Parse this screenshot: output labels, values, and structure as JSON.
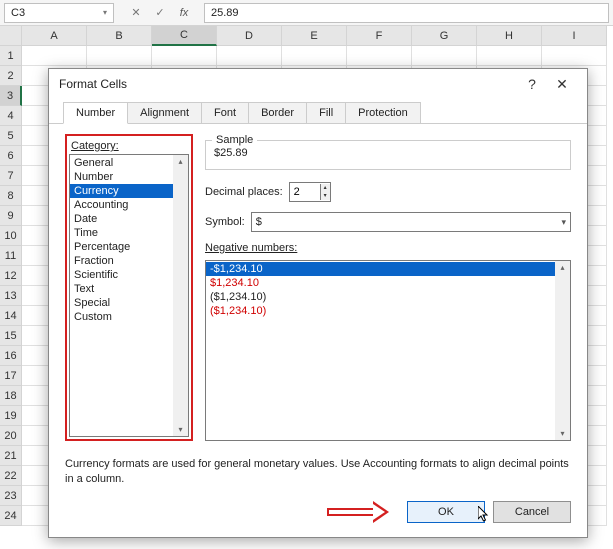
{
  "namebox": {
    "value": "C3",
    "dropdown_glyph": "▾"
  },
  "fx": {
    "cancel": "✕",
    "confirm": "✓",
    "fx_label": "fx"
  },
  "formula_bar": {
    "value": "25.89"
  },
  "columns": [
    "A",
    "B",
    "C",
    "D",
    "E",
    "F",
    "G",
    "H",
    "I"
  ],
  "selected_col_index": 2,
  "selected_row": 3,
  "row_count": 24,
  "dialog": {
    "title": "Format Cells",
    "help": "?",
    "close": "✕",
    "tabs": [
      "Number",
      "Alignment",
      "Font",
      "Border",
      "Fill",
      "Protection"
    ],
    "active_tab": 0,
    "category_label": "Category:",
    "categories": [
      "General",
      "Number",
      "Currency",
      "Accounting",
      "Date",
      "Time",
      "Percentage",
      "Fraction",
      "Scientific",
      "Text",
      "Special",
      "Custom"
    ],
    "selected_category_index": 2,
    "sample_label": "Sample",
    "sample_value": "$25.89",
    "decimal_label": "Decimal places:",
    "decimal_value": "2",
    "symbol_label": "Symbol:",
    "symbol_value": "$",
    "symbol_dd": "▾",
    "neg_label": "Negative numbers:",
    "neg_options": [
      {
        "text": "-$1,234.10",
        "red": false,
        "sel": true
      },
      {
        "text": "$1,234.10",
        "red": true,
        "sel": false
      },
      {
        "text": "($1,234.10)",
        "red": false,
        "sel": false
      },
      {
        "text": "($1,234.10)",
        "red": true,
        "sel": false
      }
    ],
    "description": "Currency formats are used for general monetary values.  Use Accounting formats to align decimal points in a column.",
    "ok": "OK",
    "cancel": "Cancel",
    "scroll_up": "▴",
    "scroll_down": "▾"
  }
}
